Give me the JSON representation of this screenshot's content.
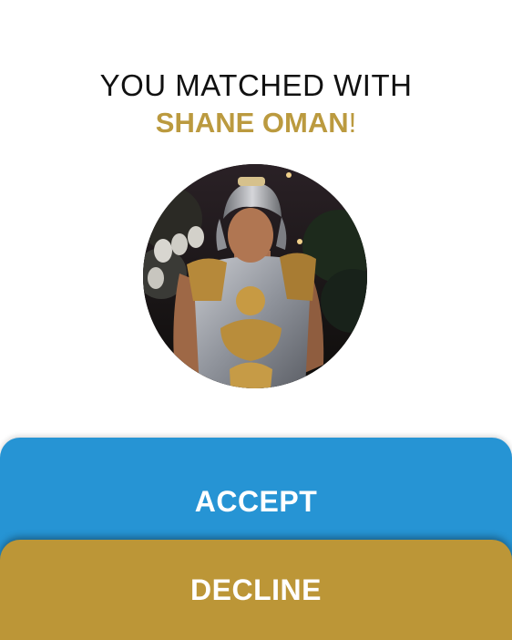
{
  "match": {
    "headline": "YOU MATCHED WITH",
    "name": "SHANE OMAN",
    "exclaim": "!"
  },
  "buttons": {
    "accept_label": "ACCEPT",
    "decline_label": "DECLINE"
  },
  "colors": {
    "name_gold": "#bb9a3f",
    "accept_blue": "#2694d4",
    "decline_gold": "#bc9637"
  }
}
